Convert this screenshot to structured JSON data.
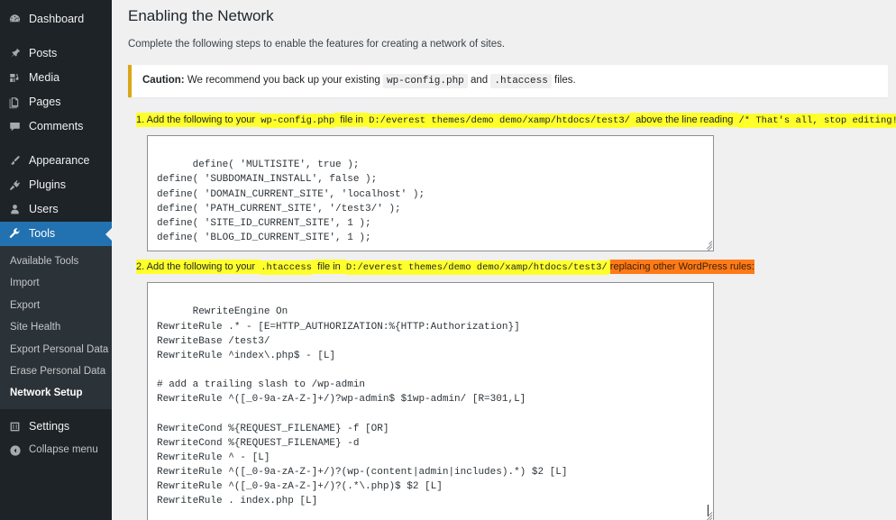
{
  "sidebar": {
    "top_items": [
      {
        "label": "Dashboard",
        "icon": "dashboard-icon",
        "current": false,
        "gap_after": true
      },
      {
        "label": "Posts",
        "icon": "pin-icon",
        "current": false,
        "gap_after": false
      },
      {
        "label": "Media",
        "icon": "media-icon",
        "current": false,
        "gap_after": false
      },
      {
        "label": "Pages",
        "icon": "pages-icon",
        "current": false,
        "gap_after": false
      },
      {
        "label": "Comments",
        "icon": "comments-icon",
        "current": false,
        "gap_after": true
      },
      {
        "label": "Appearance",
        "icon": "paintbrush-icon",
        "current": false,
        "gap_after": false
      },
      {
        "label": "Plugins",
        "icon": "plugins-icon",
        "current": false,
        "gap_after": false
      },
      {
        "label": "Users",
        "icon": "users-icon",
        "current": false,
        "gap_after": false
      },
      {
        "label": "Tools",
        "icon": "wrench-icon",
        "current": true,
        "gap_after": false
      }
    ],
    "submenu": [
      {
        "label": "Available Tools",
        "current": false
      },
      {
        "label": "Import",
        "current": false
      },
      {
        "label": "Export",
        "current": false
      },
      {
        "label": "Site Health",
        "current": false
      },
      {
        "label": "Export Personal Data",
        "current": false
      },
      {
        "label": "Erase Personal Data",
        "current": false
      },
      {
        "label": "Network Setup",
        "current": true
      }
    ],
    "settings_item": {
      "label": "Settings",
      "icon": "settings-icon"
    },
    "collapse_item": {
      "label": "Collapse menu",
      "icon": "collapse-arrow-icon"
    },
    "accent_current": "#2271b1",
    "bg": "#1d2327",
    "submenu_bg": "#2c3338"
  },
  "main": {
    "page_title": "Enabling the Network",
    "intro": "Complete the following steps to enable the features for creating a network of sites.",
    "notice": {
      "lead": "Caution:",
      "text_1": "We recommend you back up your existing",
      "code_1": "wp-config.php",
      "text_2": "and",
      "code_2": ".htaccess",
      "text_3": "files.",
      "border_color": "#dba617"
    },
    "step1": {
      "prefix": "1. Add the following to your",
      "file": "wp-config.php",
      "middle": "file in",
      "path": "D:/everest themes/demo demo/xamp/htdocs/test3/",
      "after": "above the line reading",
      "marker": "/* That's all, stop editing! Happy publishing. */",
      "suffix": ":",
      "highlight_color": "#ffff2b"
    },
    "code1": "define( 'MULTISITE', true );\ndefine( 'SUBDOMAIN_INSTALL', false );\ndefine( 'DOMAIN_CURRENT_SITE', 'localhost' );\ndefine( 'PATH_CURRENT_SITE', '/test3/' );\ndefine( 'SITE_ID_CURRENT_SITE', 1 );\ndefine( 'BLOG_ID_CURRENT_SITE', 1 );",
    "step2": {
      "prefix": "2. Add the following to your",
      "file": ".htaccess",
      "middle": "file in",
      "path": "D:/everest themes/demo demo/xamp/htdocs/test3/",
      "replacing": "replacing other WordPress rules:",
      "highlight_color": "#ffff2b",
      "replacing_color": "#ff7a18"
    },
    "code2": "RewriteEngine On\nRewriteRule .* - [E=HTTP_AUTHORIZATION:%{HTTP:Authorization}]\nRewriteBase /test3/\nRewriteRule ^index\\.php$ - [L]\n\n# add a trailing slash to /wp-admin\nRewriteRule ^([_0-9a-zA-Z-]+/)?wp-admin$ $1wp-admin/ [R=301,L]\n\nRewriteCond %{REQUEST_FILENAME} -f [OR]\nRewriteCond %{REQUEST_FILENAME} -d\nRewriteRule ^ - [L]\nRewriteRule ^([_0-9a-zA-Z-]+/)?(wp-(content|admin|includes).*) $2 [L]\nRewriteRule ^([_0-9a-zA-Z-]+/)?(.*\\.php)$ $2 [L]\nRewriteRule . index.php [L]"
  }
}
